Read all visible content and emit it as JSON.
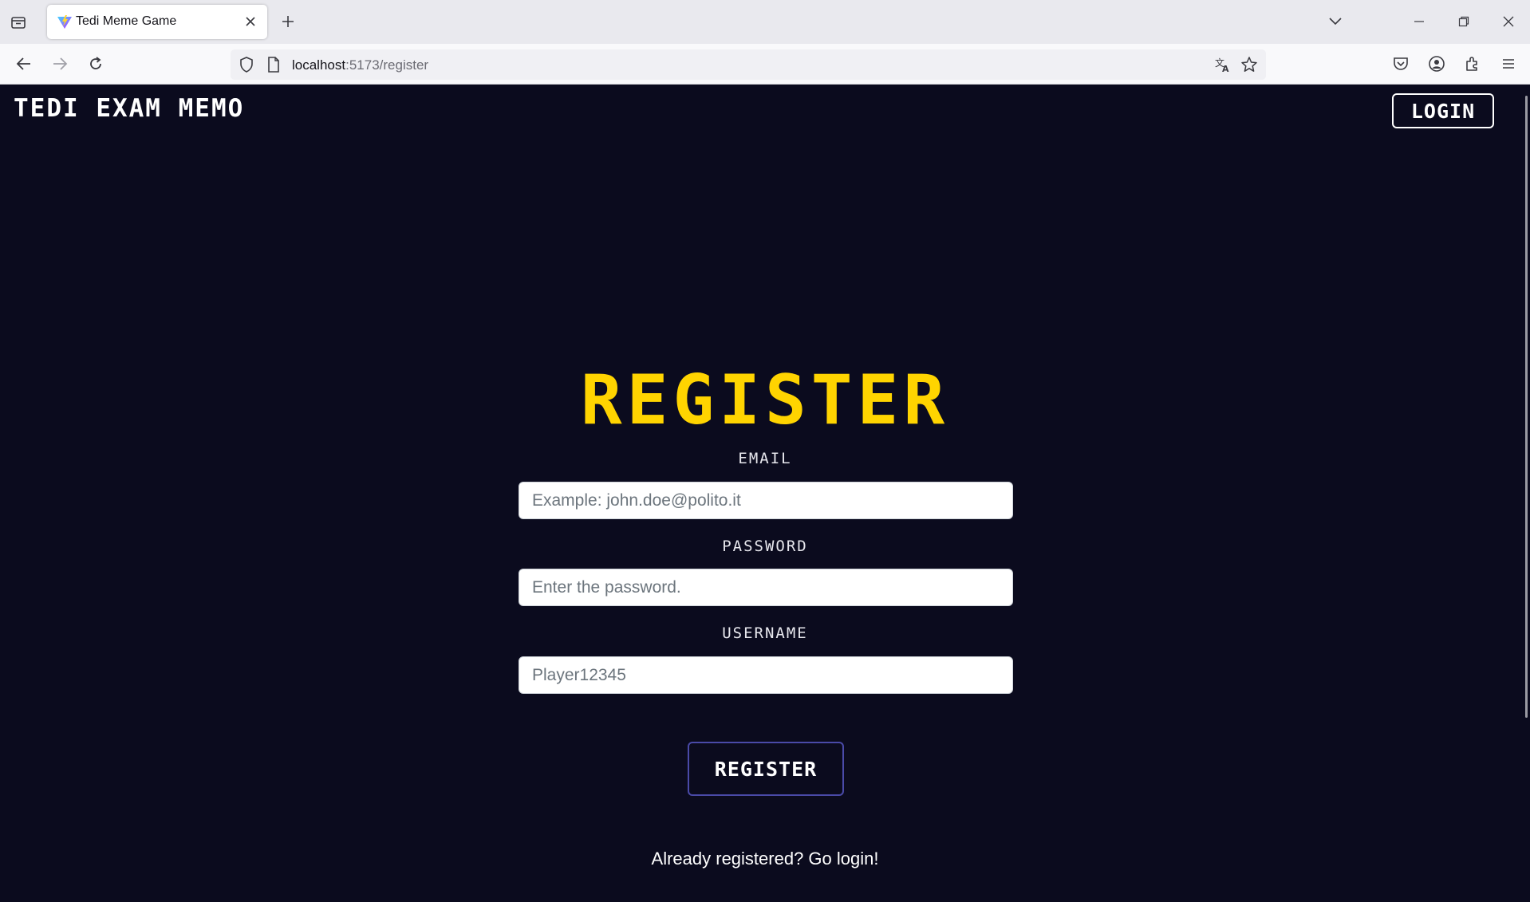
{
  "browser": {
    "tab_title": "Tedi Meme Game",
    "url_host": "localhost",
    "url_path": ":5173/register",
    "icons": {
      "tablist": "tablist-icon",
      "close_tab": "close-icon",
      "new_tab": "plus-icon",
      "list_tabs": "chevron-down-icon",
      "minimize": "minimize-icon",
      "restore": "restore-icon",
      "close_window": "close-icon",
      "back": "back-arrow-icon",
      "forward": "forward-arrow-icon",
      "reload": "reload-icon",
      "shield": "shield-icon",
      "page": "page-icon",
      "translate": "translate-icon",
      "bookmark": "star-icon",
      "pocket": "pocket-icon",
      "account": "account-icon",
      "extensions": "puzzle-icon",
      "menu": "hamburger-menu-icon"
    }
  },
  "header": {
    "brand": "TEDI EXAM MEMO",
    "login_label": "LOGIN"
  },
  "form": {
    "title": "REGISTER",
    "email": {
      "label": "EMAIL",
      "placeholder": "Example: john.doe@polito.it"
    },
    "password": {
      "label": "PASSWORD",
      "placeholder": "Enter the password."
    },
    "username": {
      "label": "USERNAME",
      "placeholder": "Player12345"
    },
    "submit_label": "REGISTER",
    "login_link": "Already registered? Go login!"
  },
  "colors": {
    "page_background": "#0b0b1e",
    "title_yellow": "#ffd400",
    "button_border": "#4a4aa8"
  }
}
